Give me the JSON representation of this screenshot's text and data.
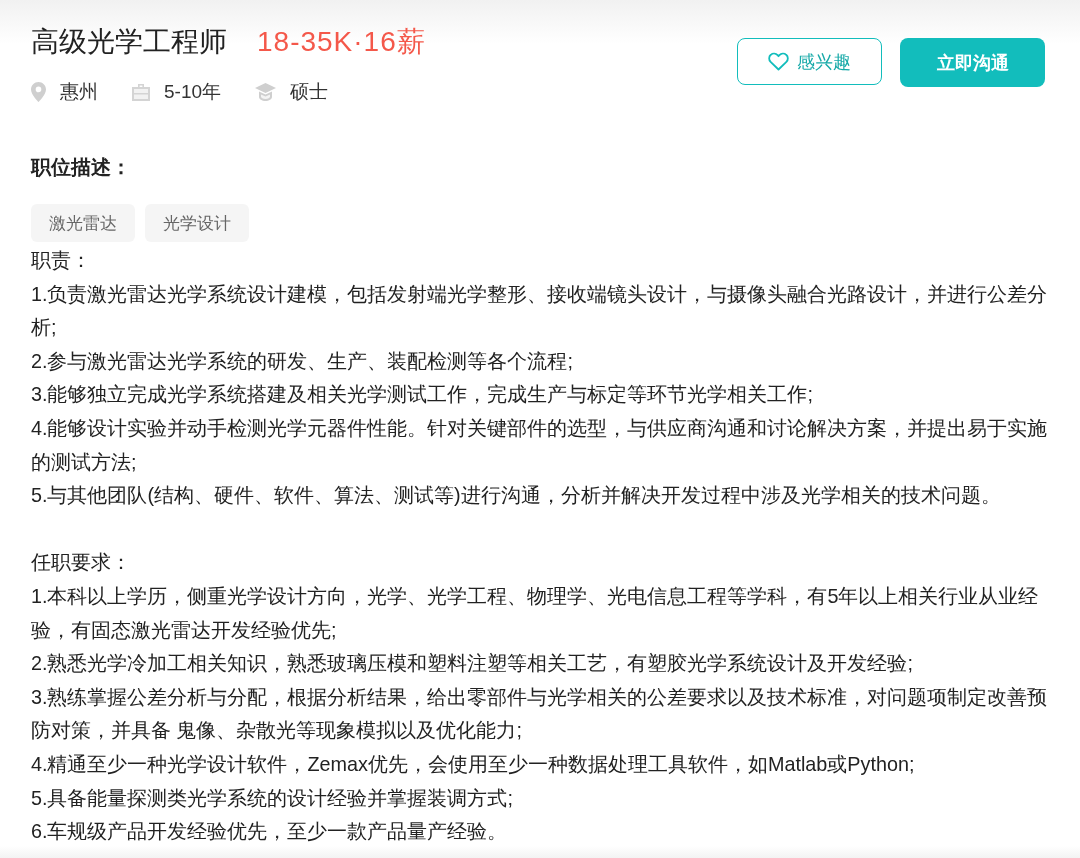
{
  "header": {
    "title": "高级光学工程师",
    "salary": "18-35K·16薪",
    "meta": [
      {
        "kind": "location",
        "text": "惠州"
      },
      {
        "kind": "experience",
        "text": "5-10年"
      },
      {
        "kind": "education",
        "text": "硕士"
      }
    ],
    "buttons": [
      {
        "kind": "outline",
        "label": "感兴趣"
      },
      {
        "kind": "primary",
        "label": "立即沟通"
      }
    ]
  },
  "description": {
    "heading": "职位描述：",
    "tags": [
      "激光雷达",
      "光学设计"
    ],
    "sections": [
      {
        "heading": "职责：",
        "items": [
          "1.负责激光雷达光学系统设计建模，包括发射端光学整形、接收端镜头设计，与摄像头融合光路设计，并进行公差分析;",
          "2.参与激光雷达光学系统的研发、生产、装配检测等各个流程;",
          "3.能够独立完成光学系统搭建及相关光学测试工作，完成生产与标定等环节光学相关工作;",
          "4.能够设计实验并动手检测光学元器件性能。针对关键部件的选型，与供应商沟通和讨论解决方案，并提出易于实施的测试方法;",
          "5.与其他团队(结构、硬件、软件、算法、测试等)进行沟通，分析并解决开发过程中涉及光学相关的技术问题。"
        ]
      },
      {
        "heading": "任职要求：",
        "items": [
          "1.本科以上学历，侧重光学设计方向，光学、光学工程、物理学、光电信息工程等学科，有5年以上相关行业从业经验，有固态激光雷达开发经验优先;",
          "2.熟悉光学冷加工相关知识，熟悉玻璃压模和塑料注塑等相关工艺，有塑胶光学系统设计及开发经验;",
          "3.熟练掌握公差分析与分配，根据分析结果，给出零部件与光学相关的公差要求以及技术标准，对问题项制定改善预防对策，并具备 鬼像、杂散光等现象模拟以及优化能力;",
          "4.精通至少一种光学设计软件，Zemax优先，会使用至少一种数据处理工具软件，如Matlab或Python;",
          "5.具备能量探测类光学系统的设计经验并掌握装调方式;",
          "6.车规级产品开发经验优先，至少一款产品量产经验。"
        ]
      }
    ]
  }
}
